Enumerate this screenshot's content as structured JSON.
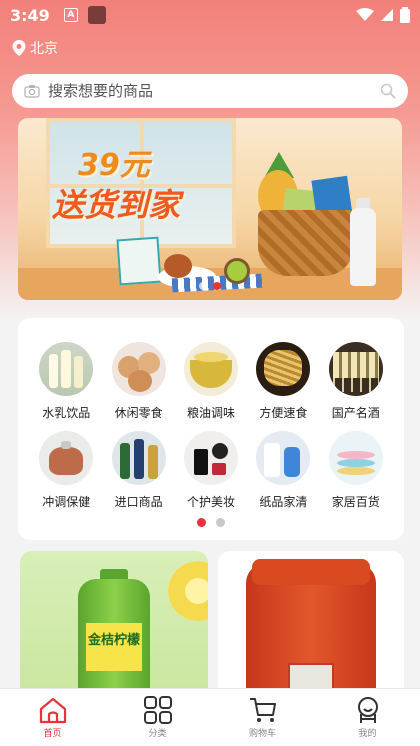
{
  "status_bar": {
    "time": "3:49",
    "badge_letter": "A"
  },
  "header": {
    "location": "北京"
  },
  "search": {
    "placeholder": "搜索想要的商品"
  },
  "banner": {
    "title_line1": "39元",
    "title_line2": "送货到家",
    "slide_count": 2,
    "active_slide": 1
  },
  "categories": {
    "items": [
      {
        "label": "水乳饮品",
        "icon": "milk-bottles-photo"
      },
      {
        "label": "休闲零食",
        "icon": "cookies-photo"
      },
      {
        "label": "粮油调味",
        "icon": "oil-bowl-photo"
      },
      {
        "label": "方便速食",
        "icon": "noodles-photo"
      },
      {
        "label": "国产名酒",
        "icon": "wine-glasses-photo"
      },
      {
        "label": "冲调保健",
        "icon": "teapot-photo"
      },
      {
        "label": "进口商品",
        "icon": "imported-bottles-photo"
      },
      {
        "label": "个护美妆",
        "icon": "cosmetics-photo"
      },
      {
        "label": "纸品家清",
        "icon": "cleaning-photo"
      },
      {
        "label": "家居百货",
        "icon": "dishes-photo"
      }
    ],
    "page_count": 2,
    "active_page": 1
  },
  "products": [
    {
      "label_text": "金桔柠檬"
    },
    {
      "label_text": ""
    }
  ],
  "bottom_nav": {
    "items": [
      {
        "label": "首页",
        "icon": "home-icon",
        "active": true
      },
      {
        "label": "分类",
        "icon": "grid-icon",
        "active": false
      },
      {
        "label": "购物车",
        "icon": "cart-icon",
        "active": false
      },
      {
        "label": "我的",
        "icon": "user-icon",
        "active": false
      }
    ]
  },
  "colors": {
    "accent": "#e8323c",
    "header_top": "#f2807a"
  }
}
